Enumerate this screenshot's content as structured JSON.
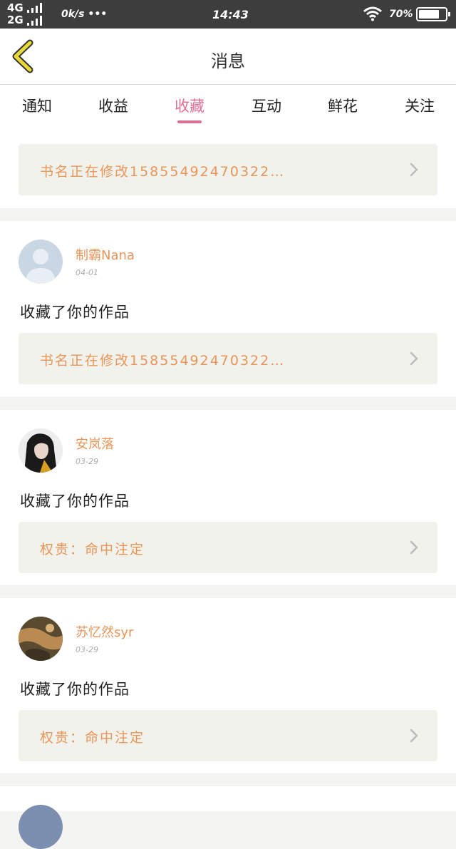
{
  "status_bar": {
    "net1": "4G",
    "net2": "2G",
    "speed": "0k/s •••",
    "time": "14:43",
    "battery_text": "70%",
    "icons": [
      "signal-icon",
      "wifi-icon",
      "battery-icon"
    ]
  },
  "nav": {
    "title": "消息",
    "back_icon": "chevron-left-icon"
  },
  "tabs": [
    {
      "label": "通知"
    },
    {
      "label": "收益"
    },
    {
      "label": "收藏"
    },
    {
      "label": "互动"
    },
    {
      "label": "鲜花"
    },
    {
      "label": "关注"
    }
  ],
  "active_tab": "收藏",
  "top_book": {
    "title": "书名正在修改15855492470322…"
  },
  "messages": [
    {
      "username": "制霸Nana",
      "date": "04-01",
      "text": "收藏了你的作品",
      "book_title": "书名正在修改15855492470322…"
    },
    {
      "username": "安岚落",
      "date": "03-29",
      "text": "收藏了你的作品",
      "book_title": "权贵：命中注定"
    },
    {
      "username": "苏忆然syr",
      "date": "03-29",
      "text": "收藏了你的作品",
      "book_title": "权贵：命中注定"
    }
  ],
  "colors": {
    "accent": "#e36e95",
    "orange": "#e8955a",
    "book_bg": "#f2f2ec",
    "status_bg": "#3d3d3d",
    "back_yellow": "#e8d838"
  }
}
